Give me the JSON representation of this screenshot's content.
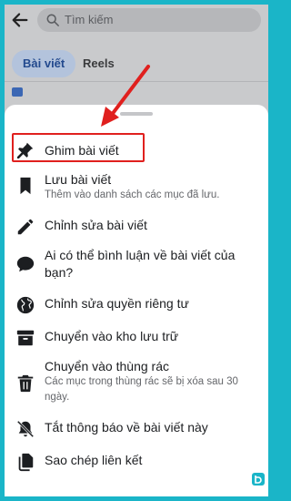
{
  "search": {
    "placeholder": "Tìm kiếm"
  },
  "tabs": [
    {
      "label": "Bài viết",
      "active": true
    },
    {
      "label": "Reels",
      "active": false
    }
  ],
  "menu": {
    "items": [
      {
        "title": "Ghim bài viết",
        "subtitle": "",
        "icon": "pin-icon",
        "highlighted": true
      },
      {
        "title": "Lưu bài viết",
        "subtitle": "Thêm vào danh sách các mục đã lưu.",
        "icon": "bookmark-icon"
      },
      {
        "title": "Chỉnh sửa bài viết",
        "subtitle": "",
        "icon": "pencil-icon"
      },
      {
        "title_line1": "Ai có thể bình luận về bài viết của",
        "title_line2": "bạn?",
        "icon": "comment-icon"
      },
      {
        "title": "Chỉnh sửa quyền riêng tư",
        "subtitle": "",
        "icon": "globe-icon"
      },
      {
        "title": "Chuyển vào kho lưu trữ",
        "subtitle": "",
        "icon": "archive-icon"
      },
      {
        "title": "Chuyển vào thùng rác",
        "subtitle_line1": "Các mục trong thùng rác sẽ bị xóa sau 30",
        "subtitle_line2": "ngày.",
        "icon": "trash-icon"
      },
      {
        "title": "Tắt thông báo về bài viết này",
        "subtitle": "",
        "icon": "bell-off-icon"
      },
      {
        "title": "Sao chép liên kết",
        "subtitle": "",
        "icon": "copy-icon"
      }
    ]
  },
  "colors": {
    "accent": "#e0201e",
    "frame": "#1ab5c8",
    "text": "#1c1e21",
    "secondary": "#65676b"
  }
}
